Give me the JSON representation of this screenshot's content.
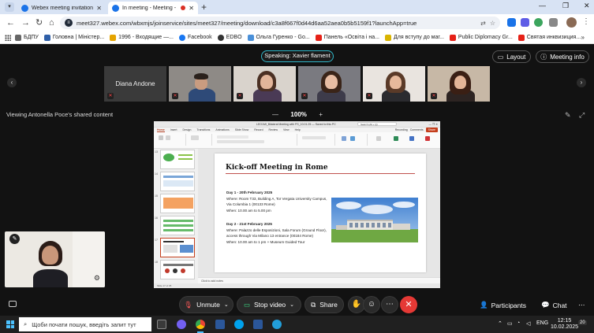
{
  "browser": {
    "tabs": [
      {
        "title": "Webex meeting invitation: LEO",
        "active": false
      },
      {
        "title": "In meeting - Meeting - Webex",
        "active": true
      }
    ],
    "url": "meet327.webex.com/wbxmjs/joinservice/sites/meet327/meeting/download/c3a8f667f0d44d6aa52aea0b5b5159f1?launchApp=true",
    "bookmarks": [
      "БДПУ",
      "Головна | Міністер...",
      "1996 - Входящие —...",
      "Facebook",
      "EDBO",
      "Ольга Гуренко - Go...",
      "Панель «Освіта і на...",
      "Для вступу до маг...",
      "Public Diplomacy Gr...",
      "Святая инквизиция..."
    ]
  },
  "meeting": {
    "speaking": "Speaking: Xavier flament",
    "layout_label": "Layout",
    "info_label": "Meeting info",
    "participant_name_tile": "Diana Andone",
    "sharing_label": "Viewing Antonella Poce's shared content",
    "zoom": {
      "minus": "—",
      "value": "100%",
      "plus": "+"
    }
  },
  "ppt": {
    "file_title": "LEO1MI_Bilateral Meeting with PS_10.01.25 — Saved to this PC",
    "search": "Search (Alt + Q)",
    "menu": [
      "Home",
      "Insert",
      "Design",
      "Transitions",
      "Animations",
      "Slide Show",
      "Record",
      "Review",
      "View",
      "Help"
    ],
    "recording_label": "Recording",
    "comments_label": "Comments",
    "share_label": "Share",
    "thumb_numbers": [
      "13",
      "14",
      "15",
      "16",
      "17",
      "18"
    ],
    "notes_placeholder": "Click to add notes",
    "status_left": "Slide 17 of 25",
    "slide": {
      "title": "Kick-off Meeting in Rome",
      "day1_heading": "Day 1 - 20th February 2025",
      "day1_where": "Where: Room T33, Building A, Tor Vergata University Campus, Via Columbia 1 (00133 Rome)",
      "day1_when": "When: 10.00 am to 5.00 pm",
      "day2_heading": "Day 2 - 21st February 2025",
      "day2_where": "Where: Palazzo delle Esposizioni, Sala Forum (Ground Floor), access through Via Milano 13 entrance (00184 Rome)",
      "day2_when": "When: 10.00 am to 1 pm + Museum Guided Tour"
    }
  },
  "controls": {
    "unmute": "Unmute",
    "stop_video": "Stop video",
    "share": "Share",
    "participants": "Participants",
    "chat": "Chat"
  },
  "taskbar": {
    "search_placeholder": "Щоби почати пошук, введіть запит тут",
    "lang": "ENG",
    "time": "12:15",
    "date": "10.02.2025",
    "notifications": "20"
  },
  "colors": {
    "accent_teal": "#2fb7c9",
    "leave_red": "#e53935",
    "ppt_orange": "#c43e1c",
    "webex_bg": "#121212"
  }
}
